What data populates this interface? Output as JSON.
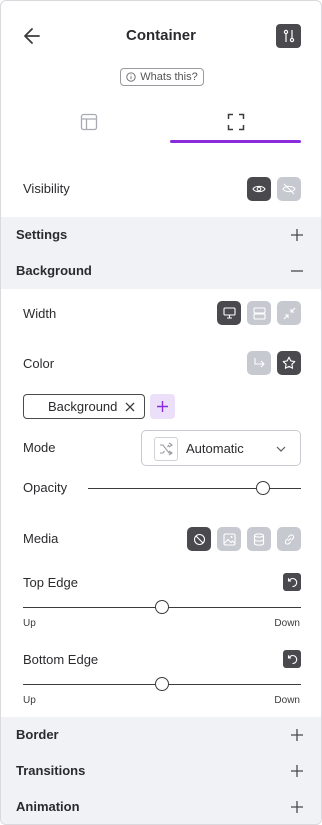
{
  "header": {
    "title": "Container",
    "whats_this": "Whats this?"
  },
  "tabs": [
    {
      "name": "layout",
      "icon": "layout-icon",
      "active": false
    },
    {
      "name": "style",
      "icon": "frame-icon",
      "active": true
    }
  ],
  "visibility": {
    "label": "Visibility",
    "options": [
      "eye-icon",
      "eye-off-icon"
    ],
    "selected": "eye-icon"
  },
  "sections": {
    "settings": "Settings",
    "background": "Background",
    "border": "Border",
    "transitions": "Transitions",
    "animation": "Animation"
  },
  "background": {
    "width": {
      "label": "Width",
      "options": [
        "desktop-icon",
        "stacked-icon",
        "shrink-icon"
      ],
      "selected": "desktop-icon"
    },
    "color": {
      "label": "Color",
      "options": [
        "link-arrow-icon",
        "star-icon"
      ],
      "selected": "star-icon"
    },
    "chip": "Background",
    "mode": {
      "label": "Mode",
      "value": "Automatic"
    },
    "opacity": {
      "label": "Opacity",
      "value": 0.82
    },
    "media": {
      "label": "Media",
      "options": [
        "none-icon",
        "image-icon",
        "database-icon",
        "link-icon"
      ],
      "selected": "none-icon"
    },
    "top_edge": {
      "label": "Top Edge",
      "value": 0.5,
      "min_label": "Up",
      "max_label": "Down"
    },
    "bottom_edge": {
      "label": "Bottom Edge",
      "value": 0.5,
      "min_label": "Up",
      "max_label": "Down"
    }
  },
  "colors": {
    "accent": "#8a2bdc",
    "dark_button": "#4a4a4e",
    "light_button": "#c7c9d0",
    "section_bg": "#f1f2f5"
  }
}
